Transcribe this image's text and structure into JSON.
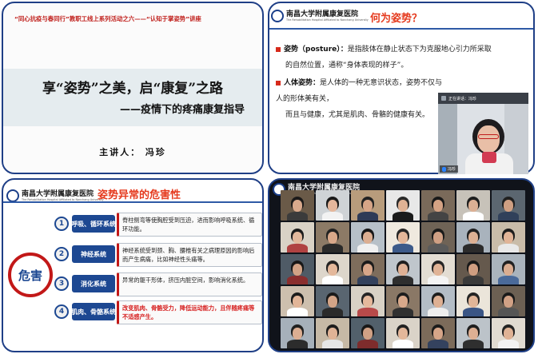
{
  "slide1": {
    "header": "“同心抗疫与春同行”教职工线上系列活动之六——“认知于掌姿势”讲座",
    "title": "享“姿势”之美，启“康复”之路",
    "subtitle": "——疫情下的疼痛康复指导",
    "speaker": "主讲人： 冯珍"
  },
  "hospital_logo": {
    "name": "南昌大学附属康复医院",
    "english": "The Rehabilitation Hospital Affiliated to Nanchang University"
  },
  "slide2": {
    "heading": "何为姿势？",
    "item1": {
      "term": "姿势（posture）：",
      "text": "是指肢体在静止状态下为克服地心引力所采取",
      "cont": "的自然位置，通称“身体表现的样子”。"
    },
    "item2": {
      "term": "人体姿势：",
      "text": "是人体的一种无意识状态，姿势不仅与人的形体美有关，",
      "cont": "而且与健康，尤其是肌肉、骨骼的健康有关。"
    },
    "video": {
      "status": "正在讲话：冯珍",
      "name": "冯珍"
    }
  },
  "slide3": {
    "heading": "姿势异常的危害性",
    "center": "危害",
    "items": [
      {
        "num": "1",
        "category": "呼吸、循环系统",
        "desc": "脊柱侧弯等使胸腔受到压迫，进而影响呼吸系统、循环功能。"
      },
      {
        "num": "2",
        "category": "神经系统",
        "desc": "神经系统受到颈、胸、腰椎有关之病理原因的影响后而产生病痛，比如神经性头痛等。"
      },
      {
        "num": "3",
        "category": "消化系统",
        "desc": "异常的躯干形体，挤压内脏空间，影响消化系统。"
      },
      {
        "num": "4",
        "category": "肌肉、骨骼系统",
        "desc": "改变肌肉、骨骼受力，降低运动能力，且伴随疼痛等不适感产生。"
      }
    ]
  },
  "meeting": {
    "participants": [
      {
        "bg": "#6a5a48",
        "hair": "#1c1a1a",
        "skin": "#d9a98c",
        "shirt": "#3b3b3b"
      },
      {
        "bg": "#cfd3d6",
        "hair": "#1a1a1a",
        "skin": "#e5b79c",
        "shirt": "#f2f2f2"
      },
      {
        "bg": "#b89c7c",
        "hair": "#222222",
        "skin": "#d6a587",
        "shirt": "#2f3b57"
      },
      {
        "bg": "#e8e8e8",
        "hair": "#2a2a2a",
        "skin": "#e0b294",
        "shirt": "#1b1b1b"
      },
      {
        "bg": "#7a6a5a",
        "hair": "#191919",
        "skin": "#d4a284",
        "shirt": "#444444"
      },
      {
        "bg": "#c7c2b9",
        "hair": "#1e1e1e",
        "skin": "#dcb094",
        "shirt": "#ffffff"
      },
      {
        "bg": "#5b6670",
        "hair": "#202020",
        "skin": "#cf9f82",
        "shirt": "#30405a"
      },
      {
        "bg": "#d9d2c6",
        "hair": "#1c1c1c",
        "skin": "#e2b89c",
        "shirt": "#b04242"
      },
      {
        "bg": "#8c7a66",
        "hair": "#222222",
        "skin": "#d8a88a",
        "shirt": "#2a2a2a"
      },
      {
        "bg": "#b7c0c8",
        "hair": "#171717",
        "skin": "#dcae91",
        "shirt": "#f0f0f0"
      },
      {
        "bg": "#efe9df",
        "hair": "#262626",
        "skin": "#e3b699",
        "shirt": "#3c5a8a"
      },
      {
        "bg": "#6f6356",
        "hair": "#1a1a1a",
        "skin": "#d0a084",
        "shirt": "#5a5a5a"
      },
      {
        "bg": "#a9b3bd",
        "hair": "#202020",
        "skin": "#ddb093",
        "shirt": "#2b2b2b"
      },
      {
        "bg": "#c9bca9",
        "hair": "#1d1d1d",
        "skin": "#e1b497",
        "shirt": "#e9e9e9"
      },
      {
        "bg": "#4f5b66",
        "hair": "#181818",
        "skin": "#d2a386",
        "shirt": "#8a2e2e"
      },
      {
        "bg": "#ddd6cb",
        "hair": "#232323",
        "skin": "#e4b89b",
        "shirt": "#ffffff"
      },
      {
        "bg": "#7e6d5c",
        "hair": "#1b1b1b",
        "skin": "#d7a689",
        "shirt": "#33415c"
      },
      {
        "bg": "#bfc6cc",
        "hair": "#1f1f1f",
        "skin": "#dfb195",
        "shirt": "#2e2e2e"
      },
      {
        "bg": "#e3ddd3",
        "hair": "#242424",
        "skin": "#e0b396",
        "shirt": "#f4f4f4"
      },
      {
        "bg": "#65594d",
        "hair": "#191919",
        "skin": "#cf9e81",
        "shirt": "#3a3a3a"
      },
      {
        "bg": "#aab4bd",
        "hair": "#212121",
        "skin": "#dbad90",
        "shirt": "#4a6a9a"
      },
      {
        "bg": "#cdbfae",
        "hair": "#1c1c1c",
        "skin": "#e2b598",
        "shirt": "#ffffff"
      },
      {
        "bg": "#596570",
        "hair": "#1a1a1a",
        "skin": "#d3a487",
        "shirt": "#2a2a2a"
      },
      {
        "bg": "#d8d1c5",
        "hair": "#252525",
        "skin": "#e5b99c",
        "shirt": "#b84a4a"
      },
      {
        "bg": "#8a7866",
        "hair": "#1d1d1d",
        "skin": "#d9a98b",
        "shirt": "#303030"
      },
      {
        "bg": "#b4bdc6",
        "hair": "#1e1e1e",
        "skin": "#deb093",
        "shirt": "#eeeeee"
      },
      {
        "bg": "#ebe5da",
        "hair": "#242424",
        "skin": "#e1b598",
        "shirt": "#3a5585"
      },
      {
        "bg": "#6c6053",
        "hair": "#1a1a1a",
        "skin": "#d1a185",
        "shirt": "#555555"
      },
      {
        "bg": "#a6b0ba",
        "hair": "#202020",
        "skin": "#dcae92",
        "shirt": "#2c2c2c"
      },
      {
        "bg": "#c6b9a6",
        "hair": "#1c1c1c",
        "skin": "#e0b396",
        "shirt": "#e6e6e6"
      },
      {
        "bg": "#52606b",
        "hair": "#181818",
        "skin": "#d0a185",
        "shirt": "#7e2c2c"
      },
      {
        "bg": "#dad3c8",
        "hair": "#222222",
        "skin": "#e3b79a",
        "shirt": "#ffffff"
      },
      {
        "bg": "#7c6b5a",
        "hair": "#1b1b1b",
        "skin": "#d6a588",
        "shirt": "#34425e"
      },
      {
        "bg": "#bcc3c9",
        "hair": "#1f1f1f",
        "skin": "#ddaf93",
        "shirt": "#2f2f2f"
      },
      {
        "bg": "#e1dbd1",
        "hair": "#232323",
        "skin": "#dfb295",
        "shirt": "#f2f2f2"
      }
    ]
  },
  "colors": {
    "frame_border": "#1f3f86",
    "heading_red": "#e53a1e",
    "category_blue": "#1d4892",
    "accent_red": "#c21818"
  }
}
